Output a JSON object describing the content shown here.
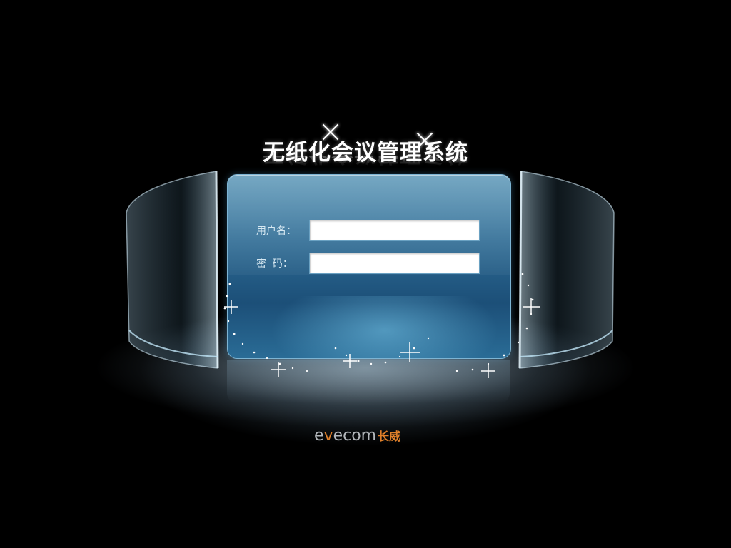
{
  "app": {
    "title": "无纸化会议管理系统"
  },
  "login": {
    "username_label": "用户名：",
    "username_value": "",
    "password_label": "密  码：",
    "password_value": ""
  },
  "brand": {
    "logo_prefix": "e",
    "logo_accent": "v",
    "logo_suffix": "ecom",
    "logo_chinese": "长威",
    "accent_color": "#e0802a",
    "panel_color": "#2d6b94"
  }
}
